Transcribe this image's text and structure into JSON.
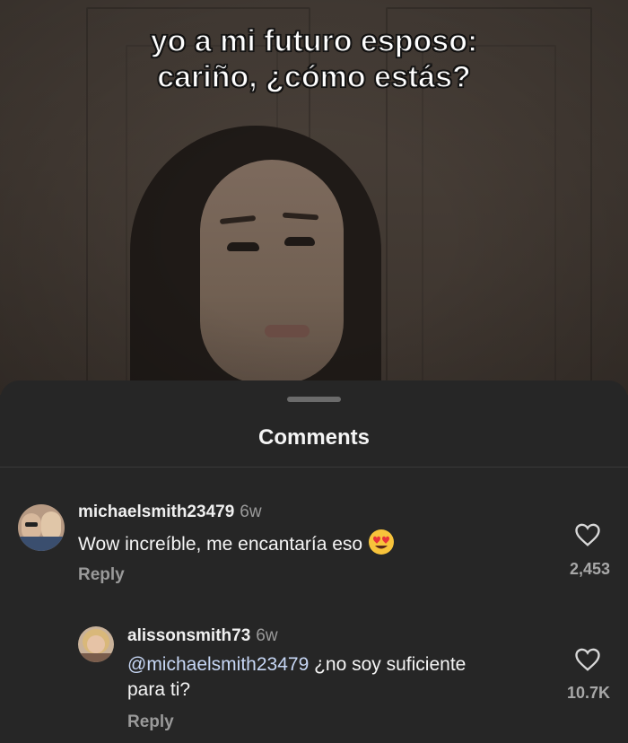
{
  "video": {
    "caption_line1": "yo a mi futuro esposo:",
    "caption_line2": "cariño, ¿cómo estás?"
  },
  "comments_sheet": {
    "title": "Comments",
    "comments": [
      {
        "username": "michaelsmith23479",
        "time": "6w",
        "text": "Wow increíble, me encantaría eso",
        "emoji": "heart-eyes-emoji",
        "reply_label": "Reply",
        "likes": "2,453"
      },
      {
        "username": "alissonsmith73",
        "time": "6w",
        "mention": "@michaelsmith23479",
        "text_line1": " ¿no soy suficiente",
        "text_line2": "para ti?",
        "reply_label": "Reply",
        "likes": "10.7K"
      }
    ]
  },
  "colors": {
    "sheet_background": "#262626",
    "mention": "#c7d7f5",
    "muted_text": "#9a9a9a"
  }
}
